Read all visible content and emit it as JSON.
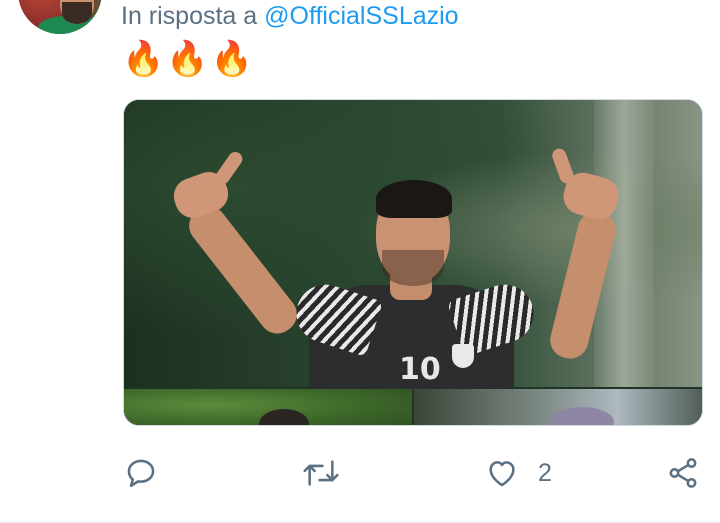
{
  "reply": {
    "prefix": "In risposta a ",
    "mention": "@OfficialSSLazio"
  },
  "tweet": {
    "text": "🔥🔥🔥"
  },
  "media": {
    "main_jersey_number": "10"
  },
  "actions": {
    "reply_icon": "comment-icon",
    "retweet_icon": "retweet-icon",
    "like_icon": "heart-icon",
    "like_count": "2",
    "share_icon": "share-icon"
  },
  "colors": {
    "secondary_text": "#5b7083",
    "mention": "#1d9bf0",
    "border": "#cfd9de"
  }
}
